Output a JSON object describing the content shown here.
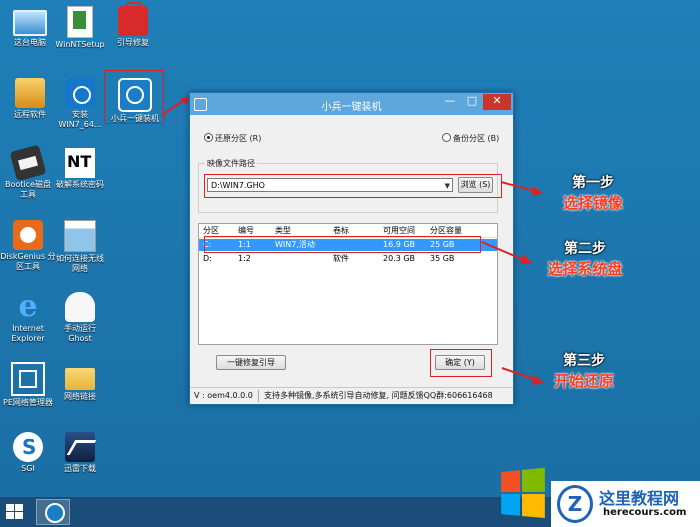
{
  "desktop": {
    "icons": [
      {
        "label": "这台电脑"
      },
      {
        "label": "WinNTSetup"
      },
      {
        "label": "引导修复"
      },
      {
        "label": "远程软件"
      },
      {
        "label": "安装 WIN7_64..."
      },
      {
        "label": "小兵一键装机"
      },
      {
        "label": "Bootice磁盘 工具"
      },
      {
        "label": "破解系统密码"
      },
      {
        "label": "DiskGenius 分区工具"
      },
      {
        "label": "如何连接无线 网络"
      },
      {
        "label": "Internet Explorer"
      },
      {
        "label": "手动运行 Ghost"
      },
      {
        "label": "PE网络管理器"
      },
      {
        "label": "网络链接"
      },
      {
        "label": "SGI"
      },
      {
        "label": "迅雷下载"
      }
    ]
  },
  "window": {
    "title": "小兵一键装机",
    "minimize": "—",
    "maximize": "□",
    "close": "✕",
    "radio_restore": "还原分区 (R)",
    "radio_backup": "备份分区 (B)",
    "image_group_label": "映像文件路径",
    "image_path": "D:\\WIN7.GHO",
    "browse_button": "浏览 (S)",
    "table": {
      "headers": [
        "分区",
        "编号",
        "类型",
        "卷标",
        "可用空间",
        "分区容量"
      ],
      "rows": [
        [
          "C:",
          "1:1",
          "WIN7,活动",
          "",
          "16.9 GB",
          "25 GB"
        ],
        [
          "D:",
          "1:2",
          "",
          "软件",
          "20.3 GB",
          "35 GB"
        ]
      ],
      "selected_row": 0
    },
    "repair_button": "一键修复引导",
    "ok_button": "确定 (Y)",
    "status_version": "V : oem4.0.0.0",
    "status_message": "支持多种镜像,多系统引导自动修复, 问题反馈QQ群:606616468"
  },
  "steps": [
    {
      "line1": "第一步",
      "line2": "选择镜像"
    },
    {
      "line1": "第二步",
      "line2": "选择系统盘"
    },
    {
      "line1": "第三步",
      "line2": "开始还原"
    }
  ],
  "watermark": {
    "logo": "Z",
    "title": "这里教程网",
    "url": "herecours.com"
  },
  "colors": {
    "desktop": "#1f7fb8",
    "titlebar": "#5ea7dc",
    "highlight": "#e02020",
    "step_text": "#ff3b1f",
    "selection": "#3399ff",
    "taskbar": "#1a4d79"
  }
}
